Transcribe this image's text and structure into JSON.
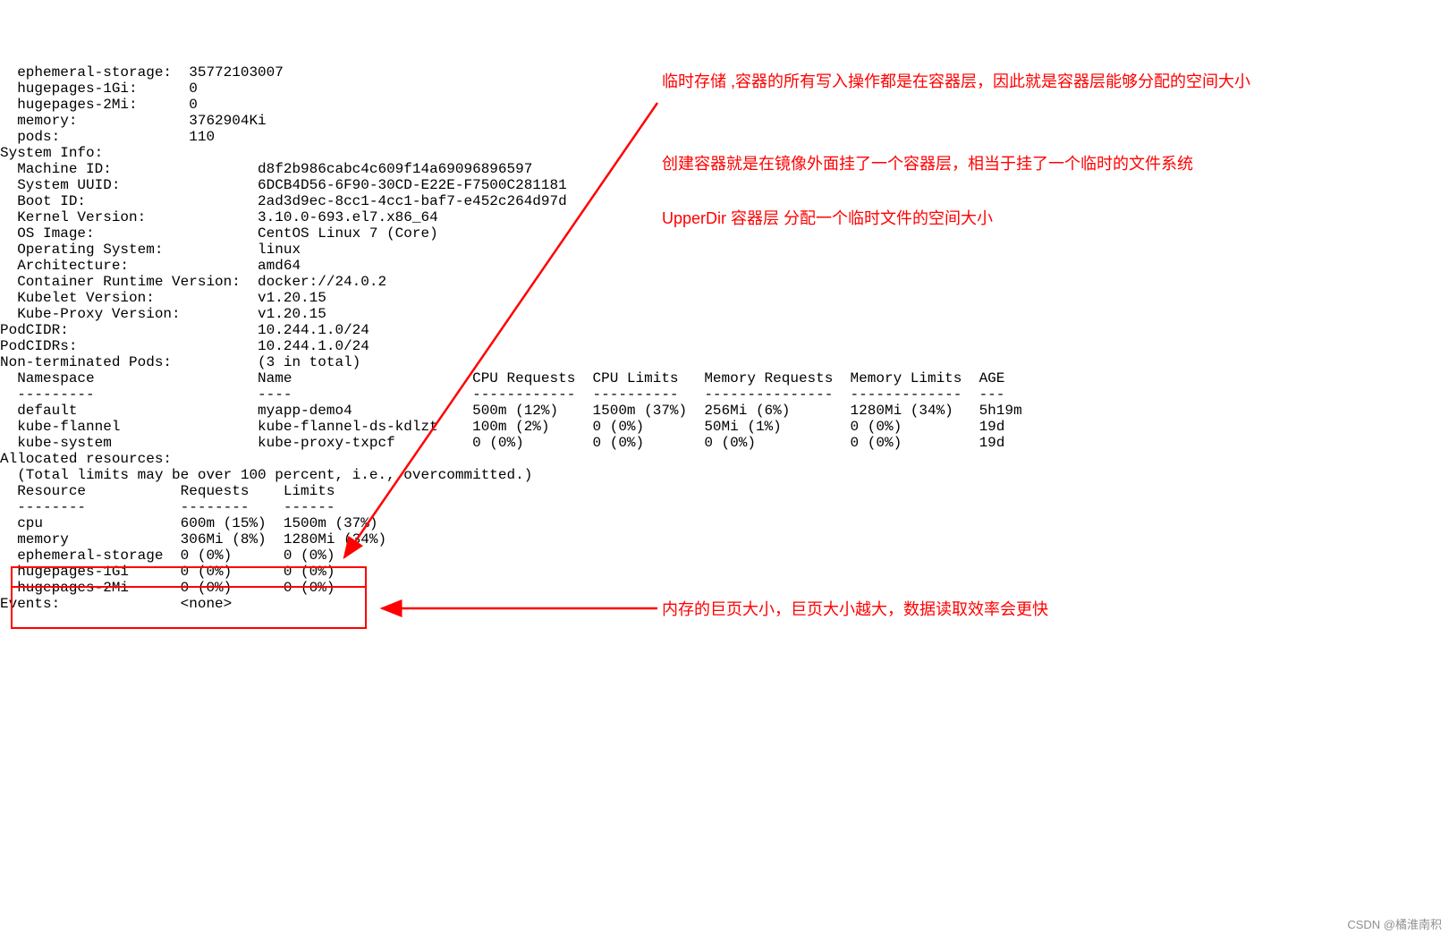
{
  "term": {
    "lines": [
      "  ephemeral-storage:  35772103007",
      "  hugepages-1Gi:      0",
      "  hugepages-2Mi:      0",
      "  memory:             3762904Ki",
      "  pods:               110",
      "System Info:",
      "  Machine ID:                 d8f2b986cabc4c609f14a69096896597",
      "  System UUID:                6DCB4D56-6F90-30CD-E22E-F7500C281181",
      "  Boot ID:                    2ad3d9ec-8cc1-4cc1-baf7-e452c264d97d",
      "  Kernel Version:             3.10.0-693.el7.x86_64",
      "  OS Image:                   CentOS Linux 7 (Core)",
      "  Operating System:           linux",
      "  Architecture:               amd64",
      "  Container Runtime Version:  docker://24.0.2",
      "  Kubelet Version:            v1.20.15",
      "  Kube-Proxy Version:         v1.20.15",
      "PodCIDR:                      10.244.1.0/24",
      "PodCIDRs:                     10.244.1.0/24",
      "Non-terminated Pods:          (3 in total)",
      "  Namespace                   Name                     CPU Requests  CPU Limits   Memory Requests  Memory Limits  AGE",
      "  ---------                   ----                     ------------  ----------   ---------------  -------------  ---",
      "  default                     myapp-demo4              500m (12%)    1500m (37%)  256Mi (6%)       1280Mi (34%)   5h19m",
      "  kube-flannel                kube-flannel-ds-kdlzt    100m (2%)     0 (0%)       50Mi (1%)        0 (0%)         19d",
      "  kube-system                 kube-proxy-txpcf         0 (0%)        0 (0%)       0 (0%)           0 (0%)         19d",
      "Allocated resources:",
      "  (Total limits may be over 100 percent, i.e., overcommitted.)",
      "  Resource           Requests    Limits",
      "  --------           --------    ------",
      "  cpu                600m (15%)  1500m (37%)",
      "  memory             306Mi (8%)  1280Mi (34%)",
      "  ephemeral-storage  0 (0%)      0 (0%)",
      "  hugepages-1Gi      0 (0%)      0 (0%)",
      "  hugepages-2Mi      0 (0%)      0 (0%)",
      "Events:              <none>"
    ]
  },
  "annotations": {
    "top1": "临时存储 ,容器的所有写入操作都是在容器层，因此就是容器层能够分配的空间大小",
    "top2": "创建容器就是在镜像外面挂了一个容器层，相当于挂了一个临时的文件系统",
    "top3": "UpperDir 容器层 分配一个临时文件的空间大小",
    "bottom": "内存的巨页大小，巨页大小越大，数据读取效率会更快"
  },
  "watermark": "CSDN @橘淮南积"
}
